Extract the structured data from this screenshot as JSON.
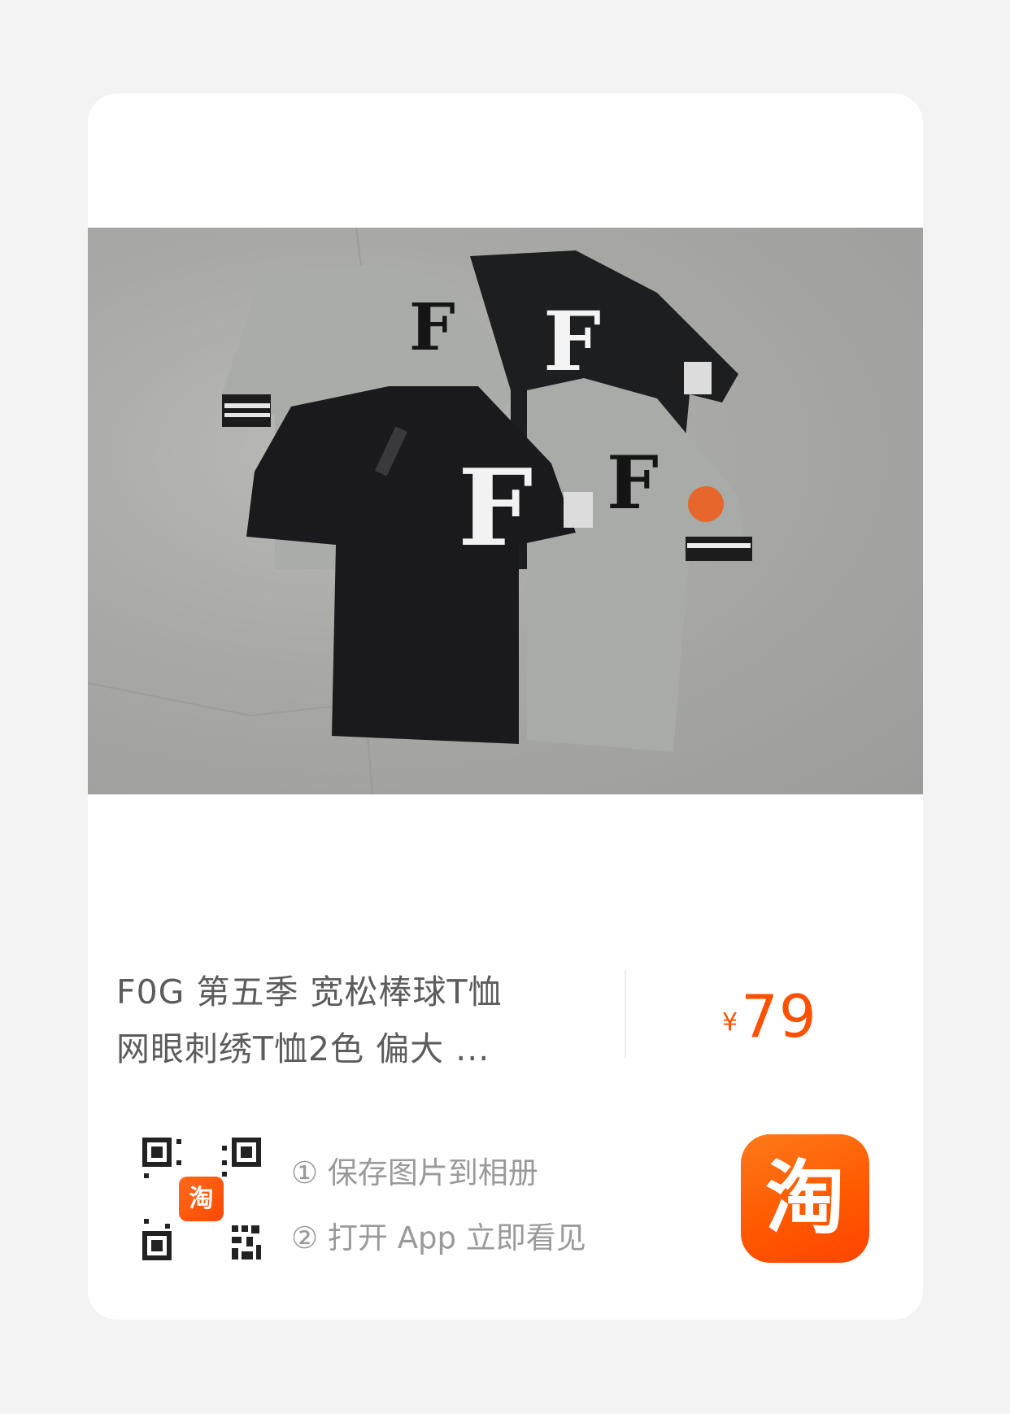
{
  "product": {
    "title_line1": "F0G 第五季 宽松棒球T恤",
    "title_line2": "网眼刺绣T恤2色 偏大 ...",
    "price_symbol": "¥",
    "price_value": "79"
  },
  "qr": {
    "badge_text": "淘"
  },
  "steps": [
    {
      "text": "① 保存图片到相册"
    },
    {
      "text": "② 打开 App 立即看见"
    }
  ],
  "app_logo": {
    "text": "淘",
    "color": "#ff5000"
  }
}
